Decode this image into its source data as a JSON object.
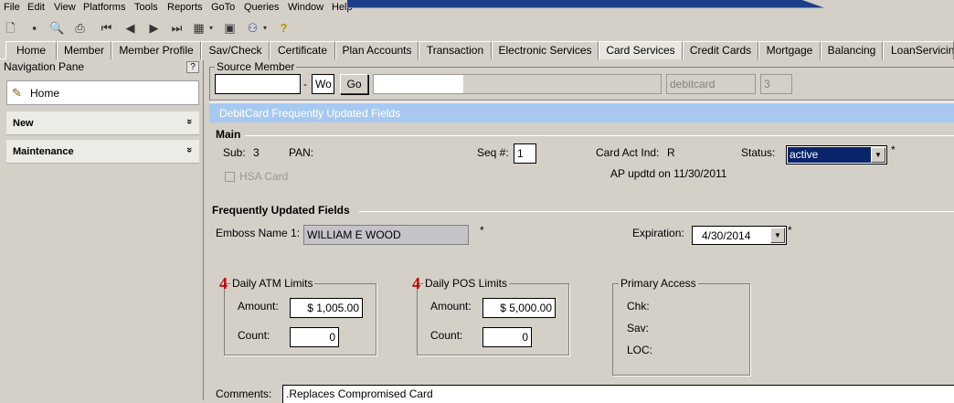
{
  "menu": [
    "File",
    "Edit",
    "View",
    "Platforms",
    "Tools",
    "Reports",
    "GoTo",
    "Queries",
    "Window",
    "Help"
  ],
  "toolbar_icons": [
    "new-icon",
    "save-icon",
    "print-preview-icon",
    "print-icon",
    "first-icon",
    "prev-icon",
    "next-icon",
    "last-icon",
    "calendar-icon",
    "dropdown-icon",
    "image-icon",
    "users-icon",
    "dropdown-icon",
    "help-icon"
  ],
  "tabs": [
    "Home",
    "Member",
    "Member Profile",
    "Sav/Check",
    "Certificate",
    "Plan Accounts",
    "Transaction",
    "Electronic Services",
    "Card Services",
    "Credit Cards",
    "Mortgage",
    "Balancing",
    "LoanServicin"
  ],
  "active_tab": "Card Services",
  "nav": {
    "title": "Navigation Pane",
    "help": "?",
    "home": "Home",
    "sections": [
      {
        "label": "New",
        "chevron": "»"
      },
      {
        "label": "Maintenance",
        "chevron": "»"
      }
    ]
  },
  "source_member": {
    "label": "Source Member",
    "member_value": "",
    "dash": "-",
    "suffix_value": "Wo",
    "go_label": "Go",
    "name_value": "",
    "type_value": "debitcard",
    "count_value": "3"
  },
  "banner": "DebitCard Frequently Updated Fields",
  "main": {
    "title": "Main",
    "sub_label": "Sub:",
    "sub_value": "3",
    "pan_label": "PAN:",
    "seq_label": "Seq #:",
    "seq_value": "1",
    "card_act_label": "Card Act Ind:",
    "card_act_value": "R",
    "status_label": "Status:",
    "status_value": "active",
    "status_required": "*",
    "ap_updated": "AP updtd on 11/30/2011",
    "hsa_label": "HSA Card"
  },
  "freq": {
    "title": "Frequently Updated Fields",
    "emboss_label": "Emboss Name 1:",
    "emboss_value": "WILLIAM E WOOD",
    "emboss_required": "*",
    "expiration_label": "Expiration:",
    "expiration_value": "4/30/2014",
    "expiration_required": "*"
  },
  "atm": {
    "badge": "4",
    "title": "Daily ATM Limits",
    "amount_label": "Amount:",
    "amount_value": "$ 1,005.00",
    "count_label": "Count:",
    "count_value": "0"
  },
  "pos": {
    "badge": "4",
    "title": "Daily POS Limits",
    "amount_label": "Amount:",
    "amount_value": "$ 5,000.00",
    "count_label": "Count:",
    "count_value": "0"
  },
  "primary_access": {
    "title": "Primary Access",
    "chk_label": "Chk:",
    "sav_label": "Sav:",
    "loc_label": "LOC:"
  },
  "comments": {
    "label": "Comments:",
    "value": ".Replaces Compromised Card"
  },
  "colors": {
    "window_bg": "#d4d0c8",
    "banner": "#a7c9f1",
    "status_selected": "#0a246a",
    "badge": "#c00000"
  }
}
